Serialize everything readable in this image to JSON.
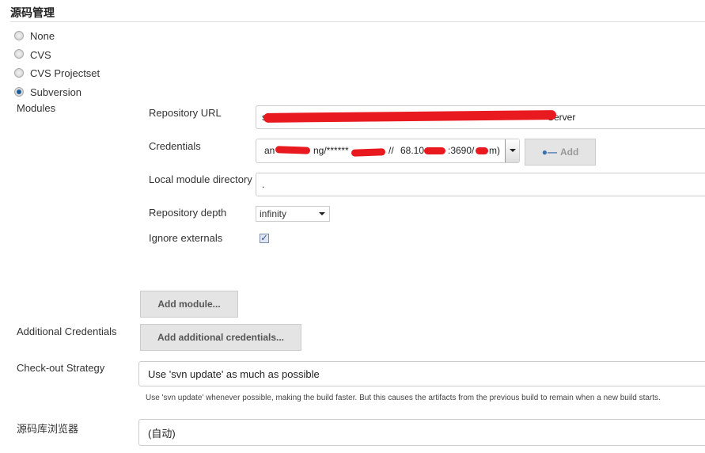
{
  "section_title": "源码管理",
  "scm_options": [
    {
      "label": "None",
      "selected": false
    },
    {
      "label": "CVS",
      "selected": false
    },
    {
      "label": "CVS Projectset",
      "selected": false
    },
    {
      "label": "Subversion",
      "selected": true
    }
  ],
  "modules": {
    "label": "Modules",
    "repository_url": {
      "label": "Repository URL",
      "value_start": "s",
      "value_end": "Server"
    },
    "credentials": {
      "label": "Credentials",
      "value_start": "an",
      "value_mid": "ng/******",
      "value_mid2": "//",
      "value_mid3": "68.10",
      "value_mid4": ":3690/",
      "value_end": "m)"
    },
    "add_button": "Add",
    "local_module_directory": {
      "label": "Local module directory",
      "value": "."
    },
    "repository_depth": {
      "label": "Repository depth",
      "value": "infinity"
    },
    "ignore_externals": {
      "label": "Ignore externals",
      "checked": true
    },
    "add_module_button": "Add module..."
  },
  "additional_credentials": {
    "label": "Additional Credentials",
    "button": "Add additional credentials..."
  },
  "checkout_strategy": {
    "label": "Check-out Strategy",
    "value": "Use 'svn update' as much as possible",
    "help": "Use 'svn update' whenever possible, making the build faster. But this causes the artifacts from the previous build to remain when a new build starts."
  },
  "repository_browser": {
    "label": "源码库浏览器",
    "value": "(自动)"
  },
  "colors": {
    "redaction": "#e8191f",
    "radio_selected": "#1b5e99"
  }
}
